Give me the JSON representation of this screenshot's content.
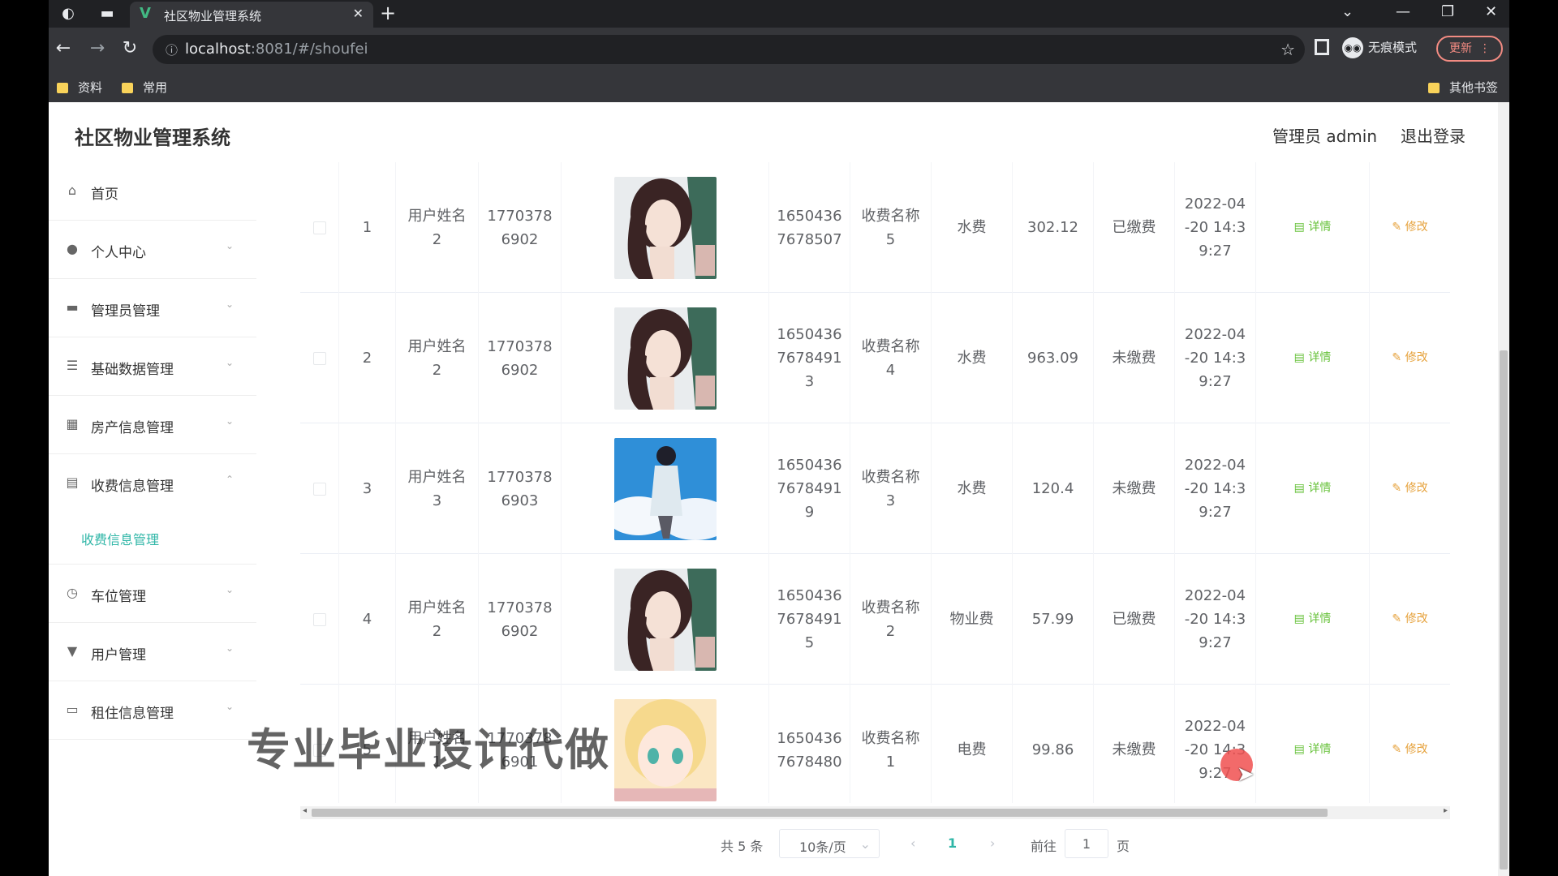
{
  "browser": {
    "tab_title": "社区物业管理系统",
    "favicon": "V",
    "url_host": "localhost",
    "url_rest": ":8081/#/shoufei",
    "incognito_label": "无痕模式",
    "update_label": "更新",
    "bookmarks": [
      "资料",
      "常用"
    ],
    "other_bookmarks": "其他书签"
  },
  "header": {
    "title": "社区物业管理系统",
    "user": "管理员 admin",
    "logout": "退出登录"
  },
  "sidebar": {
    "items": [
      {
        "label": "首页",
        "icon": "home-icon"
      },
      {
        "label": "个人中心",
        "icon": "person-icon"
      },
      {
        "label": "管理员管理",
        "icon": "admin-icon"
      },
      {
        "label": "基础数据管理",
        "icon": "list-icon"
      },
      {
        "label": "房产信息管理",
        "icon": "grid-icon"
      },
      {
        "label": "收费信息管理",
        "icon": "clipboard-icon"
      },
      {
        "label": "车位管理",
        "icon": "clock-icon"
      },
      {
        "label": "用户管理",
        "icon": "user-icon"
      },
      {
        "label": "租住信息管理",
        "icon": "monitor-icon"
      }
    ],
    "active_sub": "收费信息管理"
  },
  "table": {
    "detail_label": "详情",
    "edit_label": "修改",
    "rows": [
      {
        "idx": "1",
        "name": "用户姓名\n2",
        "phone": "1770378\n6902",
        "avatar": "woman",
        "code": "1650436\n7678507",
        "fee_name": "收费名称\n5",
        "type": "水费",
        "amount": "302.12",
        "status": "已缴费",
        "time": "2022-04\n-20 14:3\n9:27"
      },
      {
        "idx": "2",
        "name": "用户姓名\n2",
        "phone": "1770378\n6902",
        "avatar": "woman",
        "code": "1650436\n7678491\n3",
        "fee_name": "收费名称\n4",
        "type": "水费",
        "amount": "963.09",
        "status": "未缴费",
        "time": "2022-04\n-20 14:3\n9:27"
      },
      {
        "idx": "3",
        "name": "用户姓名\n3",
        "phone": "1770378\n6903",
        "avatar": "sky",
        "code": "1650436\n7678491\n9",
        "fee_name": "收费名称\n3",
        "type": "水费",
        "amount": "120.4",
        "status": "未缴费",
        "time": "2022-04\n-20 14:3\n9:27"
      },
      {
        "idx": "4",
        "name": "用户姓名\n2",
        "phone": "1770378\n6902",
        "avatar": "woman",
        "code": "1650436\n7678491\n5",
        "fee_name": "收费名称\n2",
        "type": "物业费",
        "amount": "57.99",
        "status": "已缴费",
        "time": "2022-04\n-20 14:3\n9:27"
      },
      {
        "idx": "5",
        "name": "用户姓名\n1",
        "phone": "1770378\n6901",
        "avatar": "anime",
        "code": "1650436\n7678480",
        "fee_name": "收费名称\n1",
        "type": "电费",
        "amount": "99.86",
        "status": "未缴费",
        "time": "2022-04\n-20 14:3\n9:27"
      }
    ]
  },
  "pager": {
    "total": "共 5 条",
    "page_size": "10条/页",
    "current": "1",
    "goto_label": "前往",
    "goto_value": "1",
    "page_unit": "页"
  },
  "watermark": "专业毕业设计代做",
  "colors": {
    "accent": "#2fb6a7",
    "detail": "#67c23a",
    "edit": "#e6a23c"
  }
}
